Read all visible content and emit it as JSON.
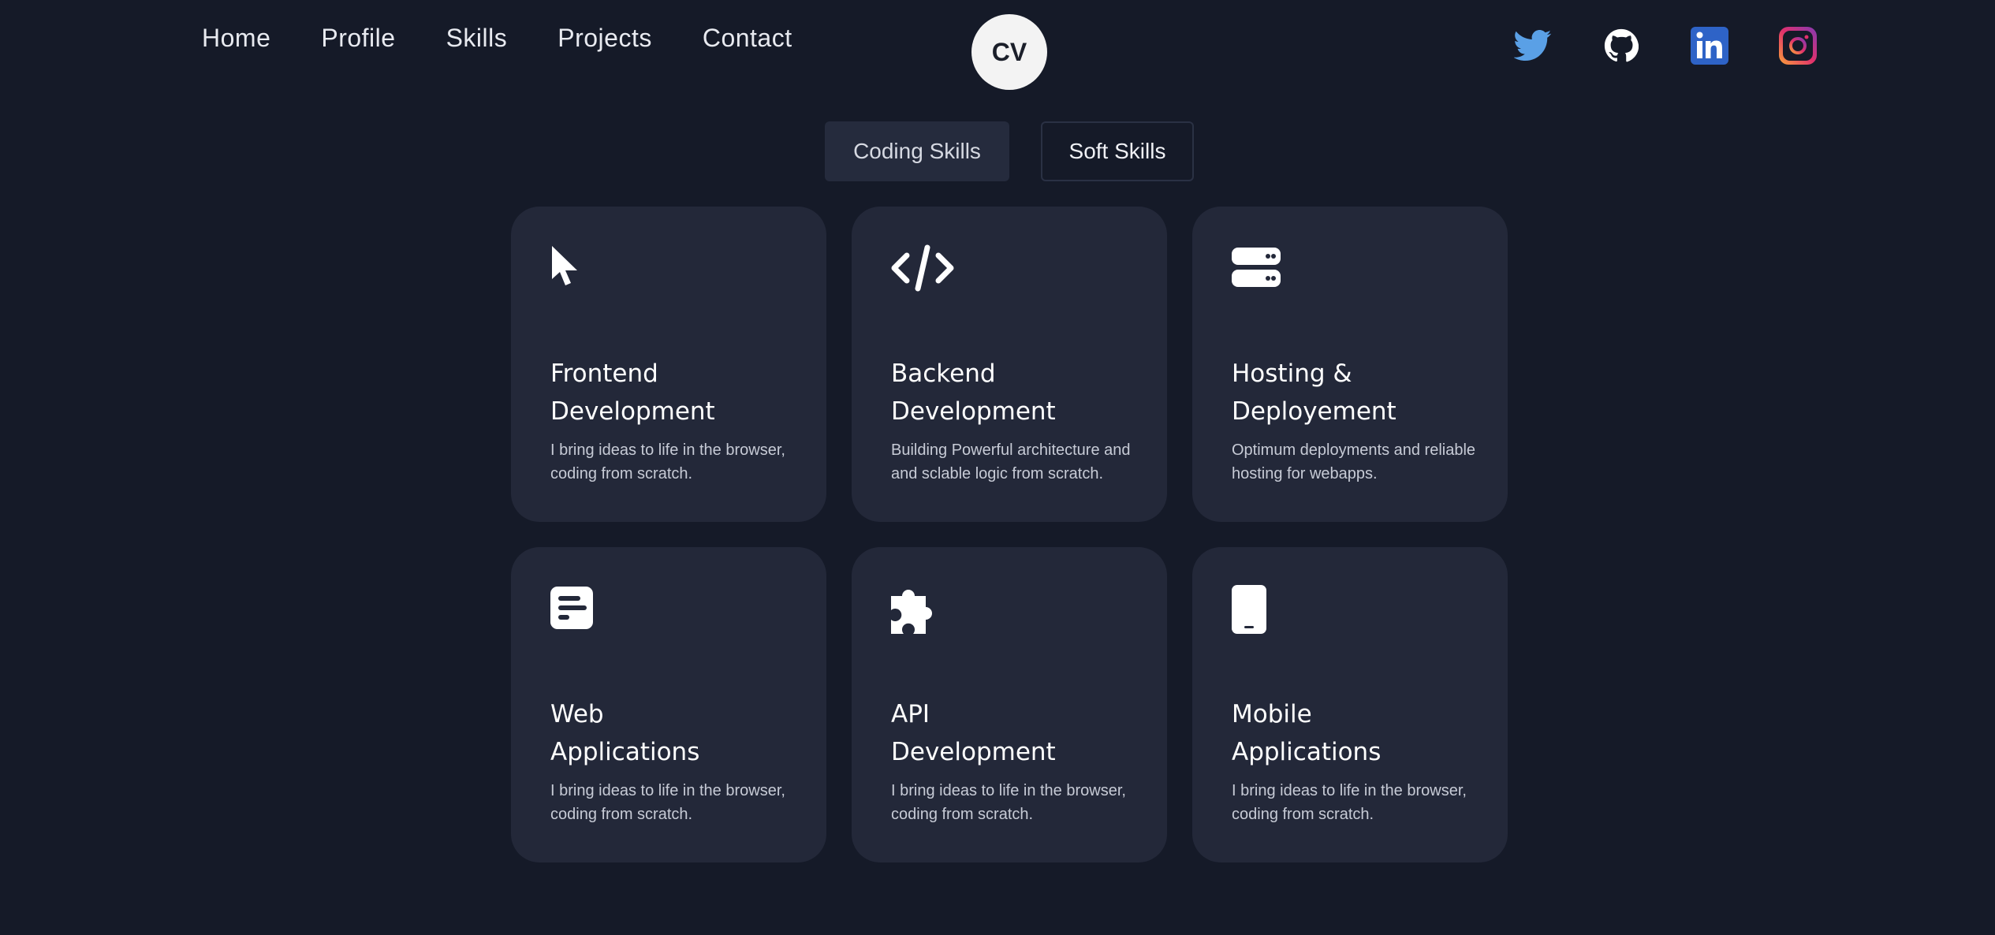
{
  "nav": {
    "items": [
      "Home",
      "Profile",
      "Skills",
      "Projects",
      "Contact"
    ]
  },
  "logo": {
    "text": "CV"
  },
  "social": {
    "icons": [
      "twitter-icon",
      "github-icon",
      "linkedin-icon",
      "instagram-icon"
    ],
    "colors": {
      "twitter": "#5aa0e6",
      "github": "#ffffff",
      "linkedin": "#2e63c7",
      "instagram": "#e1306c"
    }
  },
  "tabs": {
    "coding": "Coding Skills",
    "soft": "Soft Skills"
  },
  "cards": [
    {
      "icon": "cursor-icon",
      "title_line1": "Frontend",
      "title_line2": "Development",
      "desc_line1": "I bring ideas to life in the browser,",
      "desc_line2": "coding from scratch."
    },
    {
      "icon": "code-icon",
      "title_line1": "Backend",
      "title_line2": "Development",
      "desc_line1": "Building Powerful architecture and",
      "desc_line2": "and sclable logic from scratch."
    },
    {
      "icon": "server-icon",
      "title_line1": "Hosting &",
      "title_line2": "Deployement",
      "desc_line1": "Optimum deployments and reliable",
      "desc_line2": "hosting for webapps."
    },
    {
      "icon": "web-app-icon",
      "title_line1": "Web",
      "title_line2": "Applications",
      "desc_line1": "I bring ideas to life in the browser,",
      "desc_line2": "coding from scratch."
    },
    {
      "icon": "puzzle-icon",
      "title_line1": "API",
      "title_line2": "Development",
      "desc_line1": "I bring ideas to life in the browser,",
      "desc_line2": "coding from scratch."
    },
    {
      "icon": "mobile-icon",
      "title_line1": "Mobile",
      "title_line2": "Applications",
      "desc_line1": "I bring ideas to life in the browser,",
      "desc_line2": "coding from scratch."
    }
  ]
}
